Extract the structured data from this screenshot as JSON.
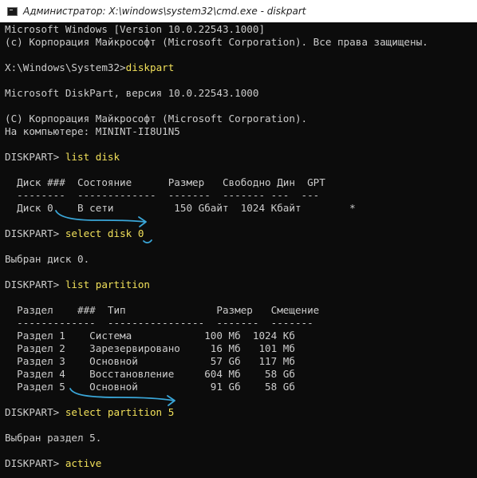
{
  "window": {
    "title": "Администратор: X:\\windows\\system32\\cmd.exe - diskpart",
    "icon": "cmd-icon"
  },
  "console": {
    "lines": [
      {
        "text": "Microsoft Windows [Version 10.0.22543.1000]"
      },
      {
        "text": "(c) Корпорация Майкрософт (Microsoft Corporation). Все права защищены."
      },
      {
        "text": ""
      },
      {
        "prompt": "X:\\Windows\\System32>",
        "command": "diskpart"
      },
      {
        "text": ""
      },
      {
        "text": "Microsoft DiskPart, версия 10.0.22543.1000"
      },
      {
        "text": ""
      },
      {
        "text": "(C) Корпорация Майкрософт (Microsoft Corporation)."
      },
      {
        "text": "На компьютере: MININT-II8U1N5"
      },
      {
        "text": ""
      },
      {
        "prompt": "DISKPART> ",
        "command": "list disk"
      },
      {
        "text": ""
      },
      {
        "text": "  Диск ###  Состояние      Размер   Свободно Дин  GPT"
      },
      {
        "text": "  --------  -------------  -------  ------- ---  ---"
      },
      {
        "text": "  Диск 0    В сети          150 Gбайт  1024 Кбайт        *"
      },
      {
        "text": ""
      },
      {
        "prompt": "DISKPART> ",
        "command": "select disk 0"
      },
      {
        "text": ""
      },
      {
        "text": "Выбран диск 0."
      },
      {
        "text": ""
      },
      {
        "prompt": "DISKPART> ",
        "command": "list partition"
      },
      {
        "text": ""
      },
      {
        "text": "  Раздел    ###  Тип               Размер   Смещение"
      },
      {
        "text": "  -------------  ----------------  -------  -------"
      },
      {
        "text": "  Раздел 1    Система            100 Мб  1024 Кб"
      },
      {
        "text": "  Раздел 2    Зарезервировано     16 Мб   101 Мб"
      },
      {
        "text": "  Раздел 3    Основной            57 Gб   117 Мб"
      },
      {
        "text": "  Раздел 4    Восстановление     604 Мб    58 Gб"
      },
      {
        "text": "  Раздел 5    Основной            91 Gб    58 Gб"
      },
      {
        "text": ""
      },
      {
        "prompt": "DISKPART> ",
        "command": "select partition 5"
      },
      {
        "text": ""
      },
      {
        "text": "Выбран раздел 5."
      },
      {
        "text": ""
      },
      {
        "prompt": "DISKPART> ",
        "command": "active"
      }
    ]
  },
  "colors": {
    "background": "#0c0c0c",
    "text": "#cccccc",
    "command": "#f1e05a",
    "annotation": "#3aa6d8"
  }
}
